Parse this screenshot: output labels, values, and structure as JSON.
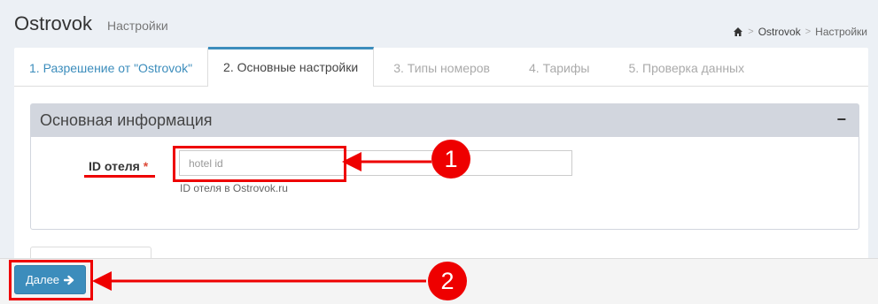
{
  "header": {
    "title": "Ostrovok",
    "subtitle": "Настройки",
    "breadcrumb": {
      "item1": "Ostrovok",
      "current": "Настройки"
    }
  },
  "tabs": [
    {
      "label": "1. Разрешение от \"Ostrovok\"",
      "state": "done"
    },
    {
      "label": "2. Основные настройки",
      "state": "active"
    },
    {
      "label": "3. Типы номеров",
      "state": "disabled"
    },
    {
      "label": "4. Тарифы",
      "state": "disabled"
    },
    {
      "label": "5. Проверка данных",
      "state": "disabled"
    }
  ],
  "box": {
    "title": "Основная информация",
    "collapse_icon": "−"
  },
  "form": {
    "hotel_id_label": "ID отеля",
    "required_mark": "*",
    "hotel_id_placeholder": "hotel id",
    "hotel_id_value": "",
    "hotel_id_help": "ID отеля в Ostrovok.ru"
  },
  "footer": {
    "next_label": "Далее",
    "next_icon": "arrow-right-icon"
  },
  "annotations": {
    "badge1": "1",
    "badge2": "2",
    "color": "#ee0000"
  }
}
